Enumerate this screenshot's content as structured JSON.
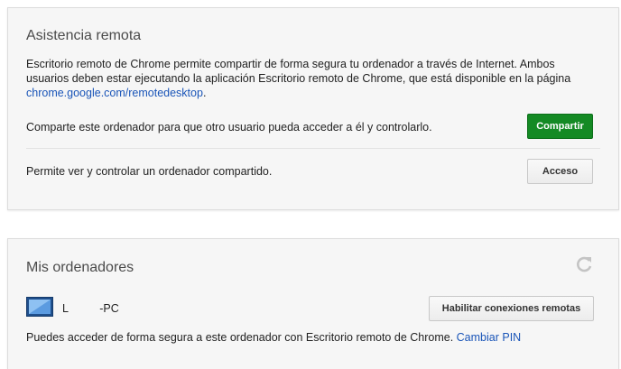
{
  "assist": {
    "title": "Asistencia remota",
    "desc_line1": "Escritorio remoto de Chrome permite compartir de forma segura tu ordenador a través de Internet. Ambos",
    "desc_line2": "usuarios deben estar ejecutando la aplicación Escritorio remoto de Chrome, que está disponible en la página",
    "desc_link": "chrome.google.com/remotedesktop",
    "desc_link_suffix": ".",
    "share_text": "Comparte este ordenador para que otro usuario pueda acceder a él y controlarlo.",
    "share_button": "Compartir",
    "access_text": "Permite ver y controlar un ordenador compartido.",
    "access_button": "Acceso"
  },
  "computers": {
    "title": "Mis ordenadores",
    "refresh_icon": "refresh-icon",
    "host_icon": "monitor-icon",
    "host_name": "L          -PC",
    "enable_button": "Habilitar conexiones remotas",
    "footer_text": "Puedes acceder de forma segura a este ordenador con Escritorio remoto de Chrome.",
    "change_pin": "Cambiar PIN"
  },
  "colors": {
    "primary_button": "#148a24",
    "link": "#1a55b8"
  }
}
